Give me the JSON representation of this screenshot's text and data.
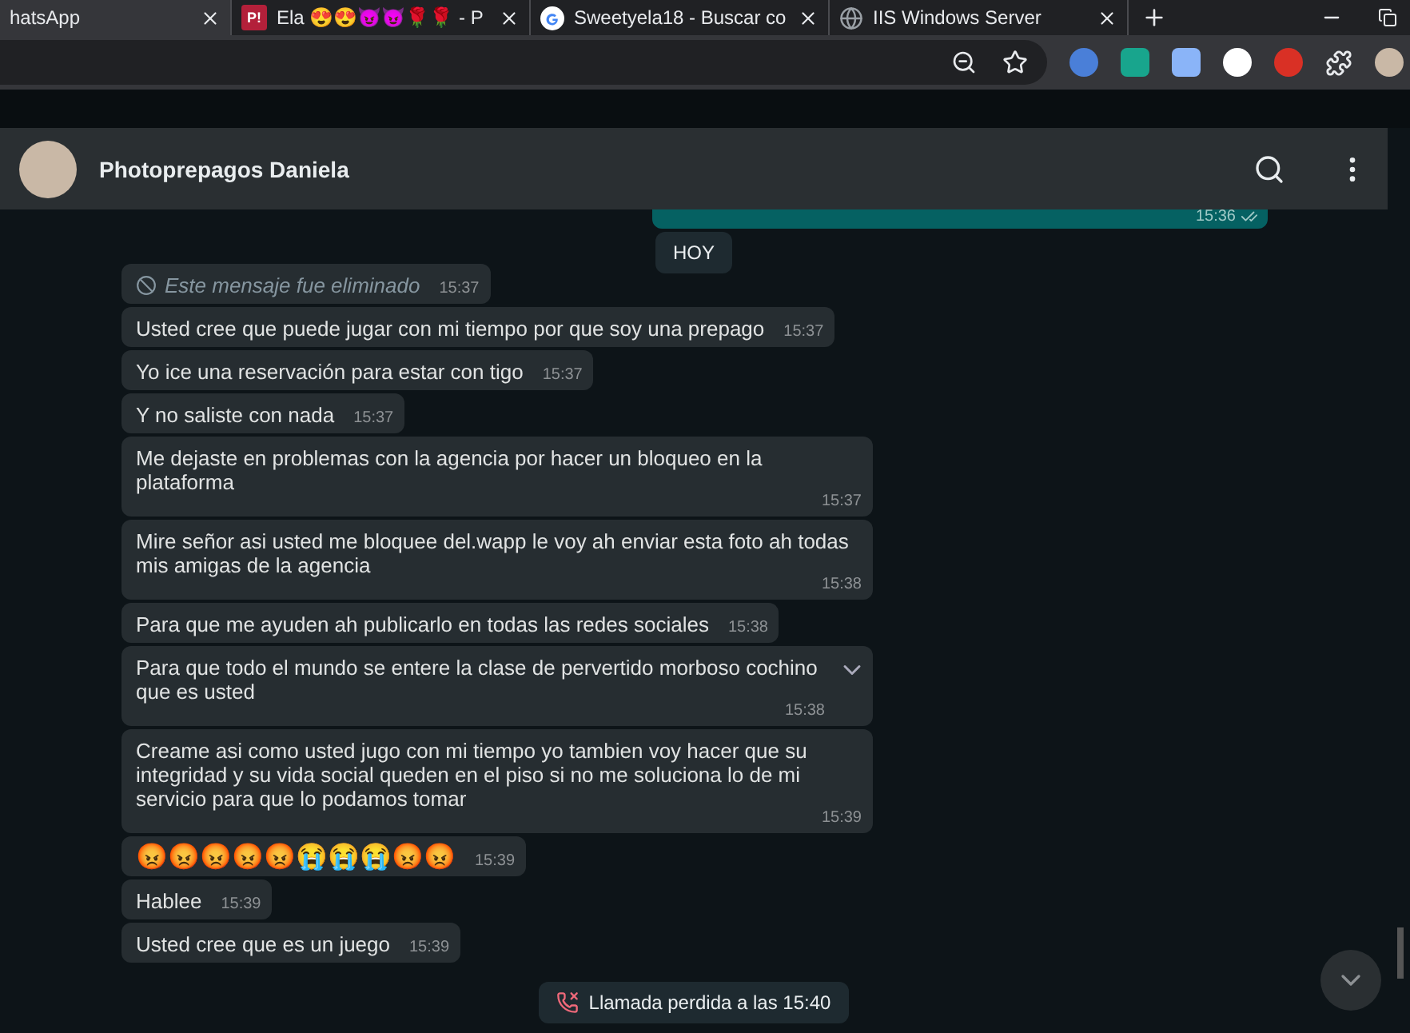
{
  "browser": {
    "tabs": [
      {
        "title": "hatsApp",
        "selected": true,
        "kind": "plain"
      },
      {
        "title": "Ela 😍😍😈😈🌹🌹 - P",
        "selected": false,
        "kind": "badge",
        "badge": "P!"
      },
      {
        "title": "Sweetyela18 - Buscar co",
        "selected": false,
        "kind": "google"
      },
      {
        "title": "IIS Windows Server",
        "selected": false,
        "kind": "globe"
      }
    ]
  },
  "chat": {
    "contact": "Photoprepagos Daniela",
    "outgoing_time": "15:36",
    "date_chip": "HOY",
    "messages": [
      {
        "kind": "deleted",
        "text": "Este mensaje fue eliminado",
        "time": "15:37",
        "hovered": false
      },
      {
        "kind": "text",
        "text": "Usted cree que puede jugar con mi tiempo por que soy una prepago",
        "time": "15:37",
        "hovered": false
      },
      {
        "kind": "text",
        "text": "Yo ice una reservación para estar con tigo",
        "time": "15:37",
        "hovered": false
      },
      {
        "kind": "text",
        "text": "Y no saliste con nada",
        "time": "15:37",
        "hovered": false
      },
      {
        "kind": "text",
        "text": "Me dejaste en problemas con la agencia por hacer un bloqueo en la plataforma",
        "time": "15:37",
        "hovered": false
      },
      {
        "kind": "text",
        "text": "Mire señor asi usted me bloquee del.wapp le voy ah enviar esta foto ah todas mis amigas de la agencia",
        "time": "15:38",
        "hovered": false
      },
      {
        "kind": "text",
        "text": "Para que me ayuden ah publicarlo en todas las redes sociales",
        "time": "15:38",
        "hovered": false
      },
      {
        "kind": "text",
        "text": "Para que todo el mundo se entere la clase de pervertido morboso cochino que es usted",
        "time": "15:38",
        "hovered": true
      },
      {
        "kind": "text",
        "text": "Creame asi como usted jugo con mi tiempo yo tambien voy hacer que su integridad y su vida social queden en el piso si no me soluciona lo de mi servicio para que lo podamos tomar",
        "time": "15:39",
        "hovered": false
      },
      {
        "kind": "emoji",
        "text": "😡😡😡😡😡😭😭😭😡😡",
        "time": "15:39",
        "hovered": false
      },
      {
        "kind": "text",
        "text": "Hablee",
        "time": "15:39",
        "hovered": false
      },
      {
        "kind": "text",
        "text": "Usted cree que es un juego",
        "time": "15:39",
        "hovered": false
      }
    ],
    "missed_call": "Llamada perdida a las 15:40"
  }
}
